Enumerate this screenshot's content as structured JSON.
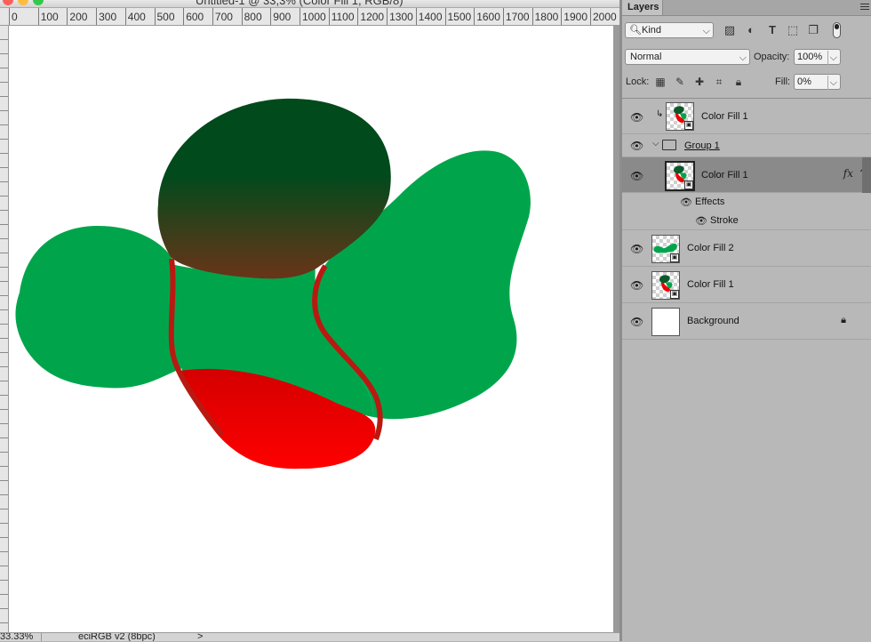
{
  "document": {
    "title": "Untitled-1 @ 33,3% (Color Fill 1, RGB/8)",
    "ruler_labels": [
      "0",
      "100",
      "200",
      "300",
      "400",
      "500",
      "600",
      "700",
      "800",
      "900",
      "1000",
      "1100",
      "1200",
      "1300",
      "1400",
      "1500",
      "1600",
      "1700",
      "1800",
      "1900",
      "2000"
    ],
    "status": {
      "zoom": "33.33%",
      "color_profile": "eciRGB v2 (8bpc)",
      "arrow": ">"
    }
  },
  "panel": {
    "tab_label": "Layers",
    "filter": {
      "kind_label": "Kind"
    },
    "blend_mode": "Normal",
    "opacity_label": "Opacity:",
    "opacity_value": "100%",
    "lock_label": "Lock:",
    "fill_label": "Fill:",
    "fill_value": "0%",
    "layers": [
      {
        "name": "Color Fill 1",
        "clipped": true
      },
      {
        "name": "Group 1",
        "group": true,
        "expanded": true
      },
      {
        "name": "Color Fill 1",
        "selected": true,
        "fx": "fx"
      },
      {
        "name": "Effects"
      },
      {
        "name": "Stroke"
      },
      {
        "name": "Color Fill 2"
      },
      {
        "name": "Color Fill 1"
      },
      {
        "name": "Background",
        "locked": true
      }
    ]
  },
  "colors": {
    "shape_green": "#00a54b",
    "shape_dark_green": "#004a1c",
    "shape_brown": "#6a3418",
    "shape_red": "#ff0000",
    "stroke_red": "#b81a12"
  }
}
